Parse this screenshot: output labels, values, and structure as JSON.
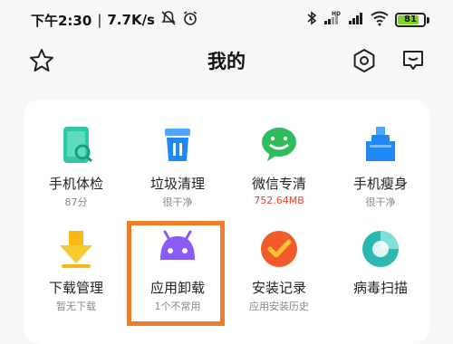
{
  "status": {
    "time": "下午2:30",
    "speed": "7.7K/s",
    "battery": "81",
    "battery_level": 81,
    "icons": [
      "dnd-icon",
      "alarm-icon",
      "bluetooth-icon",
      "signal-hd-icon",
      "signal-icon",
      "wifi-icon",
      "battery-icon"
    ]
  },
  "header": {
    "title": "我的",
    "left_icon": "star-icon",
    "right_icons": [
      "settings-icon",
      "feedback-icon"
    ]
  },
  "tools": [
    {
      "label": "手机体检",
      "sub": "87分",
      "icon": "phone-check-icon",
      "color": "#2ec7a7"
    },
    {
      "label": "垃圾清理",
      "sub": "很干净",
      "icon": "trash-icon",
      "color": "#1e88f5"
    },
    {
      "label": "微信专清",
      "sub": "752.64MB",
      "sub_color": "#e8462f",
      "icon": "wechat-clean-icon",
      "color": "#2dbd5b"
    },
    {
      "label": "手机瘦身",
      "sub": "很干净",
      "icon": "slim-icon",
      "color": "#1e88f5"
    },
    {
      "label": "下载管理",
      "sub": "暂无下载",
      "icon": "download-icon",
      "color": "#f7b916"
    },
    {
      "label": "应用卸载",
      "sub": "1个不常用",
      "icon": "android-icon",
      "color": "#8a5cf6"
    },
    {
      "label": "安装记录",
      "sub": "应用安装历史",
      "icon": "install-record-icon",
      "color": "#f25a2a"
    },
    {
      "label": "病毒扫描",
      "sub": "",
      "icon": "virus-scan-icon",
      "color": "#2ab8b0"
    }
  ],
  "colors": {
    "highlight": "#ef7d2a",
    "accent_red": "#e8462f"
  }
}
